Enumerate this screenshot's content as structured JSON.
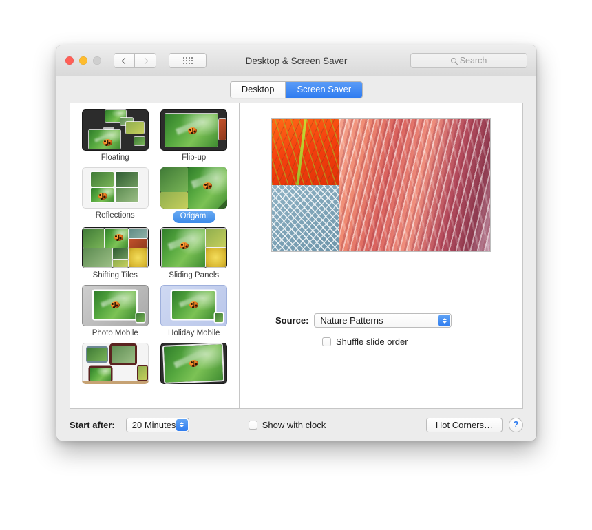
{
  "window": {
    "title": "Desktop & Screen Saver",
    "traffic_lights": [
      "close-red",
      "minimize-yellow",
      "zoom-disabled"
    ],
    "nav": {
      "back_icon": "chevron-left-icon",
      "forward_icon": "chevron-right-icon",
      "show_all_icon": "grid-dots-icon"
    },
    "search": {
      "placeholder": "Search",
      "icon": "search-icon"
    }
  },
  "tabs": [
    {
      "label": "Desktop",
      "active": false
    },
    {
      "label": "Screen Saver",
      "active": true
    }
  ],
  "screensavers": [
    {
      "label": "Floating",
      "selected": false,
      "style": "floating"
    },
    {
      "label": "Flip-up",
      "selected": false,
      "style": "flipup"
    },
    {
      "label": "Reflections",
      "selected": false,
      "style": "reflections"
    },
    {
      "label": "Origami",
      "selected": true,
      "style": "origami"
    },
    {
      "label": "Shifting Tiles",
      "selected": false,
      "style": "shiftingtiles"
    },
    {
      "label": "Sliding Panels",
      "selected": false,
      "style": "slidingpanels"
    },
    {
      "label": "Photo Mobile",
      "selected": false,
      "style": "photomobile"
    },
    {
      "label": "Holiday Mobile",
      "selected": false,
      "style": "holidaymobile"
    },
    {
      "label": "",
      "selected": false,
      "style": "photowall"
    },
    {
      "label": "",
      "selected": false,
      "style": "vintage"
    }
  ],
  "preview": {
    "alt": "Origami screen saver preview",
    "tiles": [
      "orange-leaf-macro",
      "blue-frost-crystals",
      "red-sandstone-wave"
    ]
  },
  "options": {
    "source_label": "Source:",
    "source_value": "Nature Patterns",
    "shuffle_label": "Shuffle slide order",
    "shuffle_checked": false
  },
  "footer": {
    "start_after_label": "Start after:",
    "start_after_value": "20 Minutes",
    "show_clock_label": "Show with clock",
    "show_clock_checked": false,
    "hot_corners_label": "Hot Corners…",
    "help_label": "?"
  },
  "colors": {
    "accent_blue": "#2f7cef",
    "tab_active": "#3b8ae8",
    "window_bg": "#ececec",
    "pane_bg": "#ffffff"
  }
}
